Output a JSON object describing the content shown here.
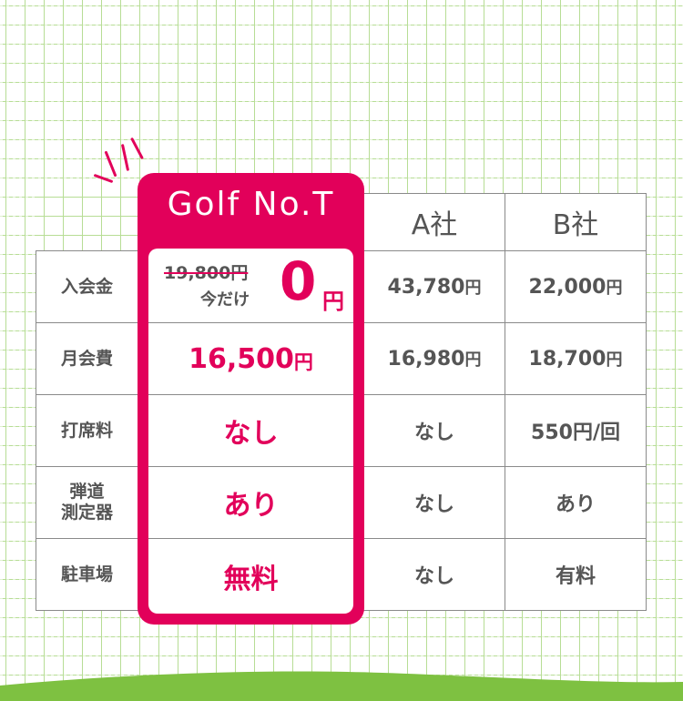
{
  "brand": {
    "name": "Golf No.T"
  },
  "competitors": {
    "a": "A社",
    "b": "B社"
  },
  "rows": {
    "labels": [
      "入会金",
      "月会費",
      "打席料",
      "弾道測定器",
      "駐車場"
    ],
    "label_lines_4": [
      "弾道",
      "測定器"
    ]
  },
  "golf": {
    "entry_old": "19,800円",
    "entry_note": "今だけ",
    "entry_now_num": "0",
    "entry_now_unit": "円",
    "monthly_num": "16,500",
    "monthly_unit": "円",
    "bay_fee": "なし",
    "launch_monitor": "あり",
    "parking": "無料"
  },
  "a": {
    "entry_num": "43,780",
    "entry_unit": "円",
    "monthly_num": "16,980",
    "monthly_unit": "円",
    "bay_fee": "なし",
    "launch_monitor": "なし",
    "parking": "なし"
  },
  "b": {
    "entry_num": "22,000",
    "entry_unit": "円",
    "monthly_num": "18,700",
    "monthly_unit": "円",
    "bay_fee": "550円/回",
    "launch_monitor": "あり",
    "parking": "有料"
  },
  "colors": {
    "accent": "#e2005a",
    "grid": "#b7dd95",
    "ground": "#7ec141",
    "text": "#555555"
  }
}
